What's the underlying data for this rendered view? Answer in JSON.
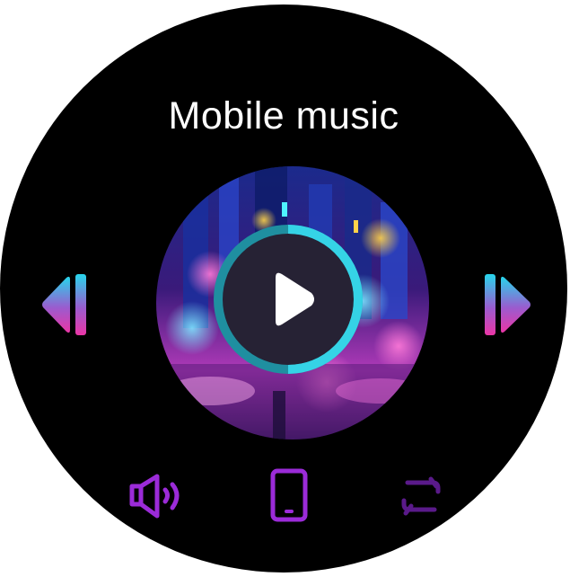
{
  "screen": {
    "title": "Mobile music"
  },
  "player": {
    "state": "paused",
    "progress": 0.5,
    "controls": {
      "previous_icon": "skip-previous-icon",
      "play_icon": "play-icon",
      "next_icon": "skip-next-icon"
    }
  },
  "bottom_bar": {
    "volume_icon": "volume-icon",
    "device_icon": "phone-device-icon",
    "mode_icon": "repeat-icon"
  },
  "colors": {
    "background": "#000000",
    "title": "#ffffff",
    "accent_cyan": "#22d3e6",
    "accent_magenta": "#e53aa6",
    "accent_purple": "#9b2bd8",
    "ring_teal": "#1f9fb0",
    "play_button_fill": "#262234"
  }
}
